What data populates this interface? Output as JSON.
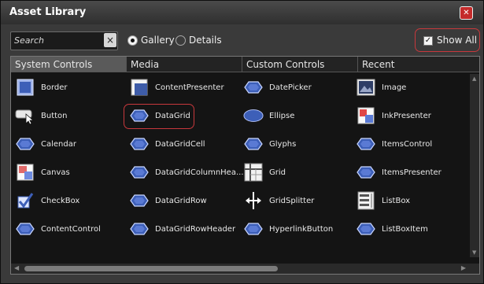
{
  "window": {
    "title": "Asset Library"
  },
  "search": {
    "placeholder": "Search",
    "clear_label": "×"
  },
  "view": {
    "gallery_label": "Gallery",
    "details_label": "Details",
    "selected": "Gallery"
  },
  "show_all": {
    "label": "Show All",
    "checked": true,
    "check_glyph": "✓"
  },
  "tabs": [
    "System Controls",
    "Media",
    "Custom Controls",
    "Recent"
  ],
  "active_tab": "System Controls",
  "items": [
    [
      "Border",
      "ContentPresenter",
      "DatePicker",
      "Image"
    ],
    [
      "Button",
      "DataGrid",
      "Ellipse",
      "InkPresenter"
    ],
    [
      "Calendar",
      "DataGridCell",
      "Glyphs",
      "ItemsControl"
    ],
    [
      "Canvas",
      "DataGridColumnHea...",
      "Grid",
      "ItemsPresenter"
    ],
    [
      "CheckBox",
      "DataGridRow",
      "GridSplitter",
      "ListBox"
    ],
    [
      "ContentControl",
      "DataGridRowHeader",
      "HyperlinkButton",
      "ListBoxItem"
    ]
  ],
  "icons": [
    [
      "border-icon",
      "content-presenter-icon",
      "control-icon",
      "image-icon"
    ],
    [
      "button-icon",
      "control-icon",
      "ellipse-icon",
      "ink-presenter-icon"
    ],
    [
      "control-icon",
      "control-icon",
      "control-icon",
      "control-icon"
    ],
    [
      "canvas-icon",
      "control-icon",
      "grid-icon",
      "control-icon"
    ],
    [
      "checkbox-icon",
      "control-icon",
      "grid-splitter-icon",
      "listbox-icon"
    ],
    [
      "control-icon",
      "control-icon",
      "control-icon",
      "control-icon"
    ]
  ],
  "colors": {
    "accent": "#c8383c",
    "control_blue": "#3d5fb8",
    "window_bg": "#3a3a3a",
    "panel_bg": "#141414"
  }
}
